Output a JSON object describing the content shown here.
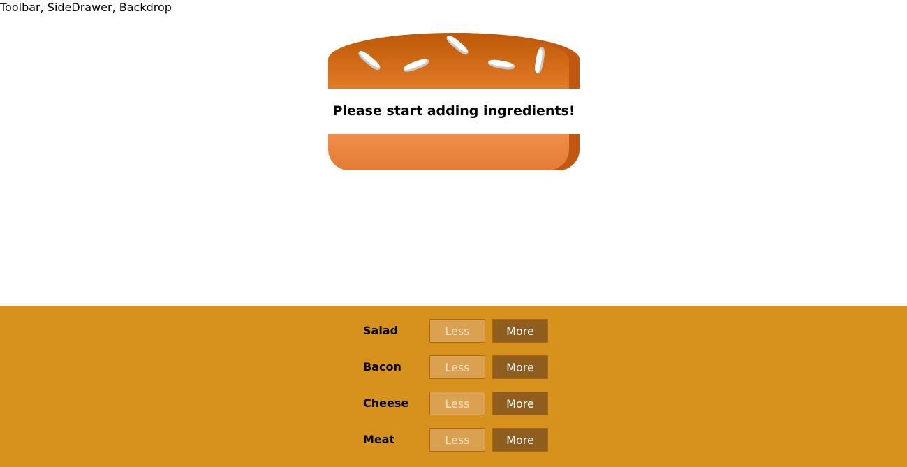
{
  "header": {
    "placeholder_text": "Toolbar, SideDrawer, Backdrop"
  },
  "burger": {
    "empty_message": "Please start adding ingredients!"
  },
  "controls": [
    {
      "label": "Salad",
      "less_label": "Less",
      "more_label": "More"
    },
    {
      "label": "Bacon",
      "less_label": "Less",
      "more_label": "More"
    },
    {
      "label": "Cheese",
      "less_label": "Less",
      "more_label": "More"
    },
    {
      "label": "Meat",
      "less_label": "Less",
      "more_label": "More"
    }
  ],
  "colors": {
    "controls_background": "#d6921c",
    "more_button": "#8f5e1e",
    "less_button": "#daa150",
    "bread": "#e27b25"
  }
}
